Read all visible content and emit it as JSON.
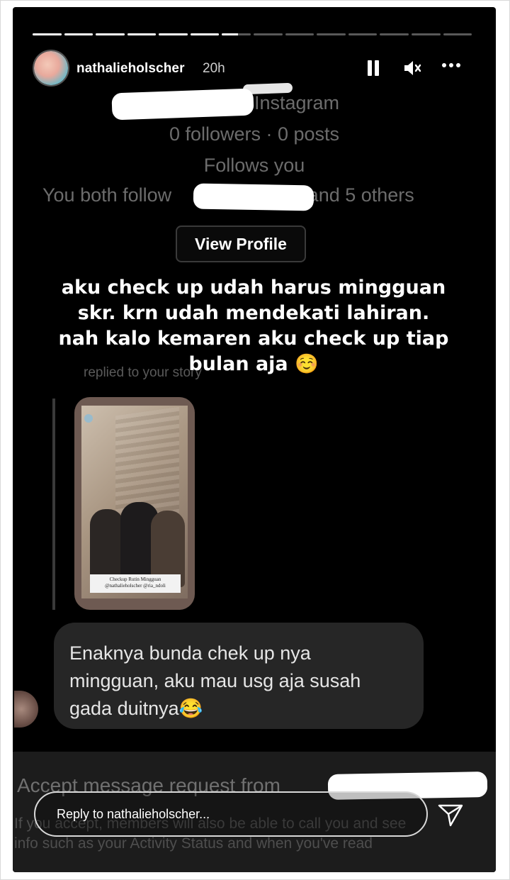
{
  "story": {
    "progress_segments": 14,
    "active_segment": 7,
    "active_fill": 0.55
  },
  "header": {
    "username": "nathalieholscher",
    "time": "20h"
  },
  "dm_profile": {
    "source": "Instagram",
    "stats": "0 followers · 0 posts",
    "follows_you": "Follows you",
    "mutuals_prefix": "You both follow",
    "mutuals_suffix": "5 and 5 others",
    "view_profile": "View Profile"
  },
  "caption": {
    "line1": "aku check up udah harus mingguan",
    "line2": "skr. krn udah mendekati lahiran.",
    "line3": "nah kalo kemaren aku check up tiap",
    "line4": "bulan aja ☺️"
  },
  "replied_label": "replied to your story",
  "story_thumb": {
    "label_line1": "Checkup Rutin Mingguan",
    "label_line2": "@nathalieholscher @ria_ndoli"
  },
  "message": {
    "line1": "Enaknya bunda chek up nya",
    "line2": "mingguan, aku mau usg aja susah",
    "line3": "gada duitnya😂"
  },
  "request": {
    "accept_text": "Accept message request from",
    "fine_line1": "If you accept, members will also be able to call you and see",
    "fine_line2": "info such as your Activity Status and when you've read"
  },
  "reply": {
    "placeholder": "Reply to nathalieholscher..."
  }
}
